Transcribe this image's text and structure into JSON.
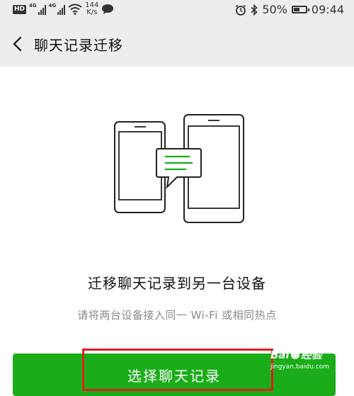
{
  "status_bar": {
    "hd_badge": "HD",
    "network_1": "4G",
    "network_2": "4G",
    "speed_value": "144",
    "speed_unit": "K/s",
    "battery_percent": "50%",
    "time": "09:44"
  },
  "header": {
    "title": "聊天记录迁移"
  },
  "main": {
    "headline": "迁移聊天记录到另一台设备",
    "subtext": "请将两台设备接入同一 Wi-Fi 或相同热点",
    "button_label": "选择聊天记录"
  },
  "watermark": {
    "brand": "Bai",
    "brand_suffix": "经验",
    "url": "jingyan.baidu.com"
  },
  "colors": {
    "accent": "#1aad19",
    "highlight": "#e02020",
    "bar_bg": "#ededed"
  }
}
